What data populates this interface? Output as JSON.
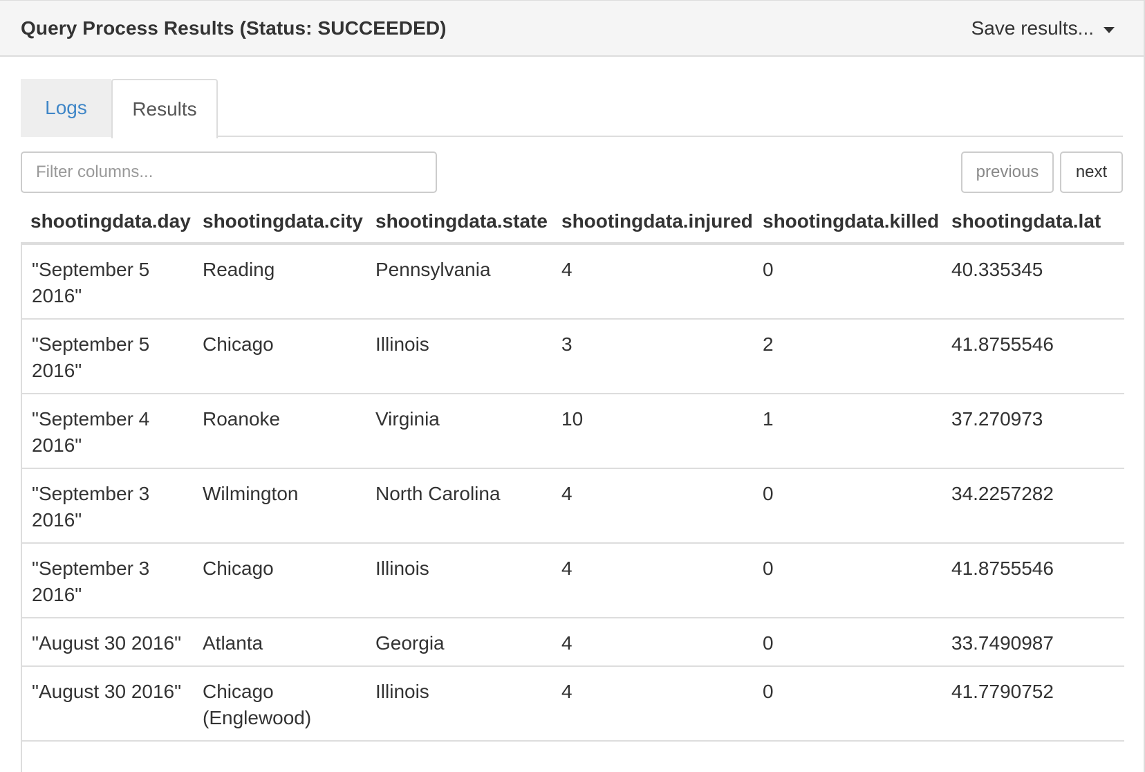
{
  "header": {
    "title": "Query Process Results (Status: SUCCEEDED)",
    "save_label": "Save results..."
  },
  "tabs": [
    {
      "label": "Logs",
      "active": false
    },
    {
      "label": "Results",
      "active": true
    }
  ],
  "filter": {
    "placeholder": "Filter columns...",
    "value": ""
  },
  "pager": {
    "previous_label": "previous",
    "next_label": "next"
  },
  "table": {
    "columns": [
      "shootingdata.day",
      "shootingdata.city",
      "shootingdata.state",
      "shootingdata.injured",
      "shootingdata.killed",
      "shootingdata.lat"
    ],
    "rows": [
      {
        "day": [
          "\"September 5",
          "2016\""
        ],
        "city": [
          "Reading"
        ],
        "state": "Pennsylvania",
        "injured": "4",
        "killed": "0",
        "lat": "40.335345"
      },
      {
        "day": [
          "\"September 5",
          "2016\""
        ],
        "city": [
          "Chicago"
        ],
        "state": "Illinois",
        "injured": "3",
        "killed": "2",
        "lat": "41.8755546"
      },
      {
        "day": [
          "\"September 4",
          "2016\""
        ],
        "city": [
          "Roanoke"
        ],
        "state": "Virginia",
        "injured": "10",
        "killed": "1",
        "lat": "37.270973"
      },
      {
        "day": [
          "\"September 3",
          "2016\""
        ],
        "city": [
          "Wilmington"
        ],
        "state": "North Carolina",
        "injured": "4",
        "killed": "0",
        "lat": "34.2257282"
      },
      {
        "day": [
          "\"September 3",
          "2016\""
        ],
        "city": [
          "Chicago"
        ],
        "state": "Illinois",
        "injured": "4",
        "killed": "0",
        "lat": "41.8755546"
      },
      {
        "day": [
          "\"August 30 2016\""
        ],
        "city": [
          "Atlanta"
        ],
        "state": "Georgia",
        "injured": "4",
        "killed": "0",
        "lat": "33.7490987"
      },
      {
        "day": [
          "\"August 30 2016\""
        ],
        "city": [
          "Chicago",
          "(Englewood)"
        ],
        "state": "Illinois",
        "injured": "4",
        "killed": "0",
        "lat": "41.7790752"
      }
    ]
  }
}
